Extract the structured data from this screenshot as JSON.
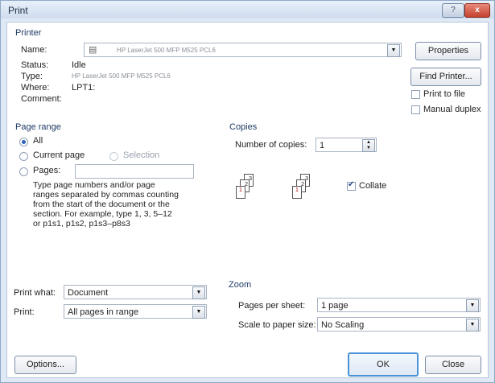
{
  "window": {
    "title": "Print",
    "help_label": "?",
    "close_label": "x"
  },
  "printer": {
    "group_label": "Printer",
    "name_label": "Name:",
    "name_value": "HP LaserJet 500 MFP M525 PCL6",
    "status_label": "Status:",
    "status_value": "Idle",
    "type_label": "Type:",
    "type_value": "HP LaserJet 500 MFP M525 PCL6",
    "where_label": "Where:",
    "where_value": "LPT1:",
    "comment_label": "Comment:",
    "properties_button": "Properties",
    "find_printer_button": "Find Printer...",
    "print_to_file": "Print to file",
    "manual_duplex": "Manual duplex"
  },
  "page_range": {
    "group_label": "Page range",
    "all": "All",
    "current_page": "Current page",
    "selection": "Selection",
    "pages": "Pages:",
    "pages_value": "",
    "hint": [
      "Type page numbers and/or page",
      "ranges separated by commas counting",
      "from the start of the document or the",
      "section. For example, type 1, 3, 5–12",
      "or p1s1, p1s2, p1s3–p8s3"
    ]
  },
  "copies": {
    "group_label": "Copies",
    "number_label": "Number of copies:",
    "number_value": "1",
    "collate": "Collate",
    "page_labels": [
      "3",
      "2",
      "1",
      "3",
      "2",
      "1"
    ]
  },
  "print_what": {
    "label": "Print what:",
    "value": "Document"
  },
  "print": {
    "label": "Print:",
    "value": "All pages in range"
  },
  "zoom": {
    "group_label": "Zoom",
    "pages_per_sheet_label": "Pages per sheet:",
    "pages_per_sheet_value": "1 page",
    "scale_label": "Scale to paper size:",
    "scale_value": "No Scaling"
  },
  "footer": {
    "options_button": "Options...",
    "ok_button": "OK",
    "close_button": "Close"
  },
  "icons": {
    "printer": "printer-icon",
    "dropdown": "chevron-down-icon",
    "spinner": "spinner-icon"
  }
}
